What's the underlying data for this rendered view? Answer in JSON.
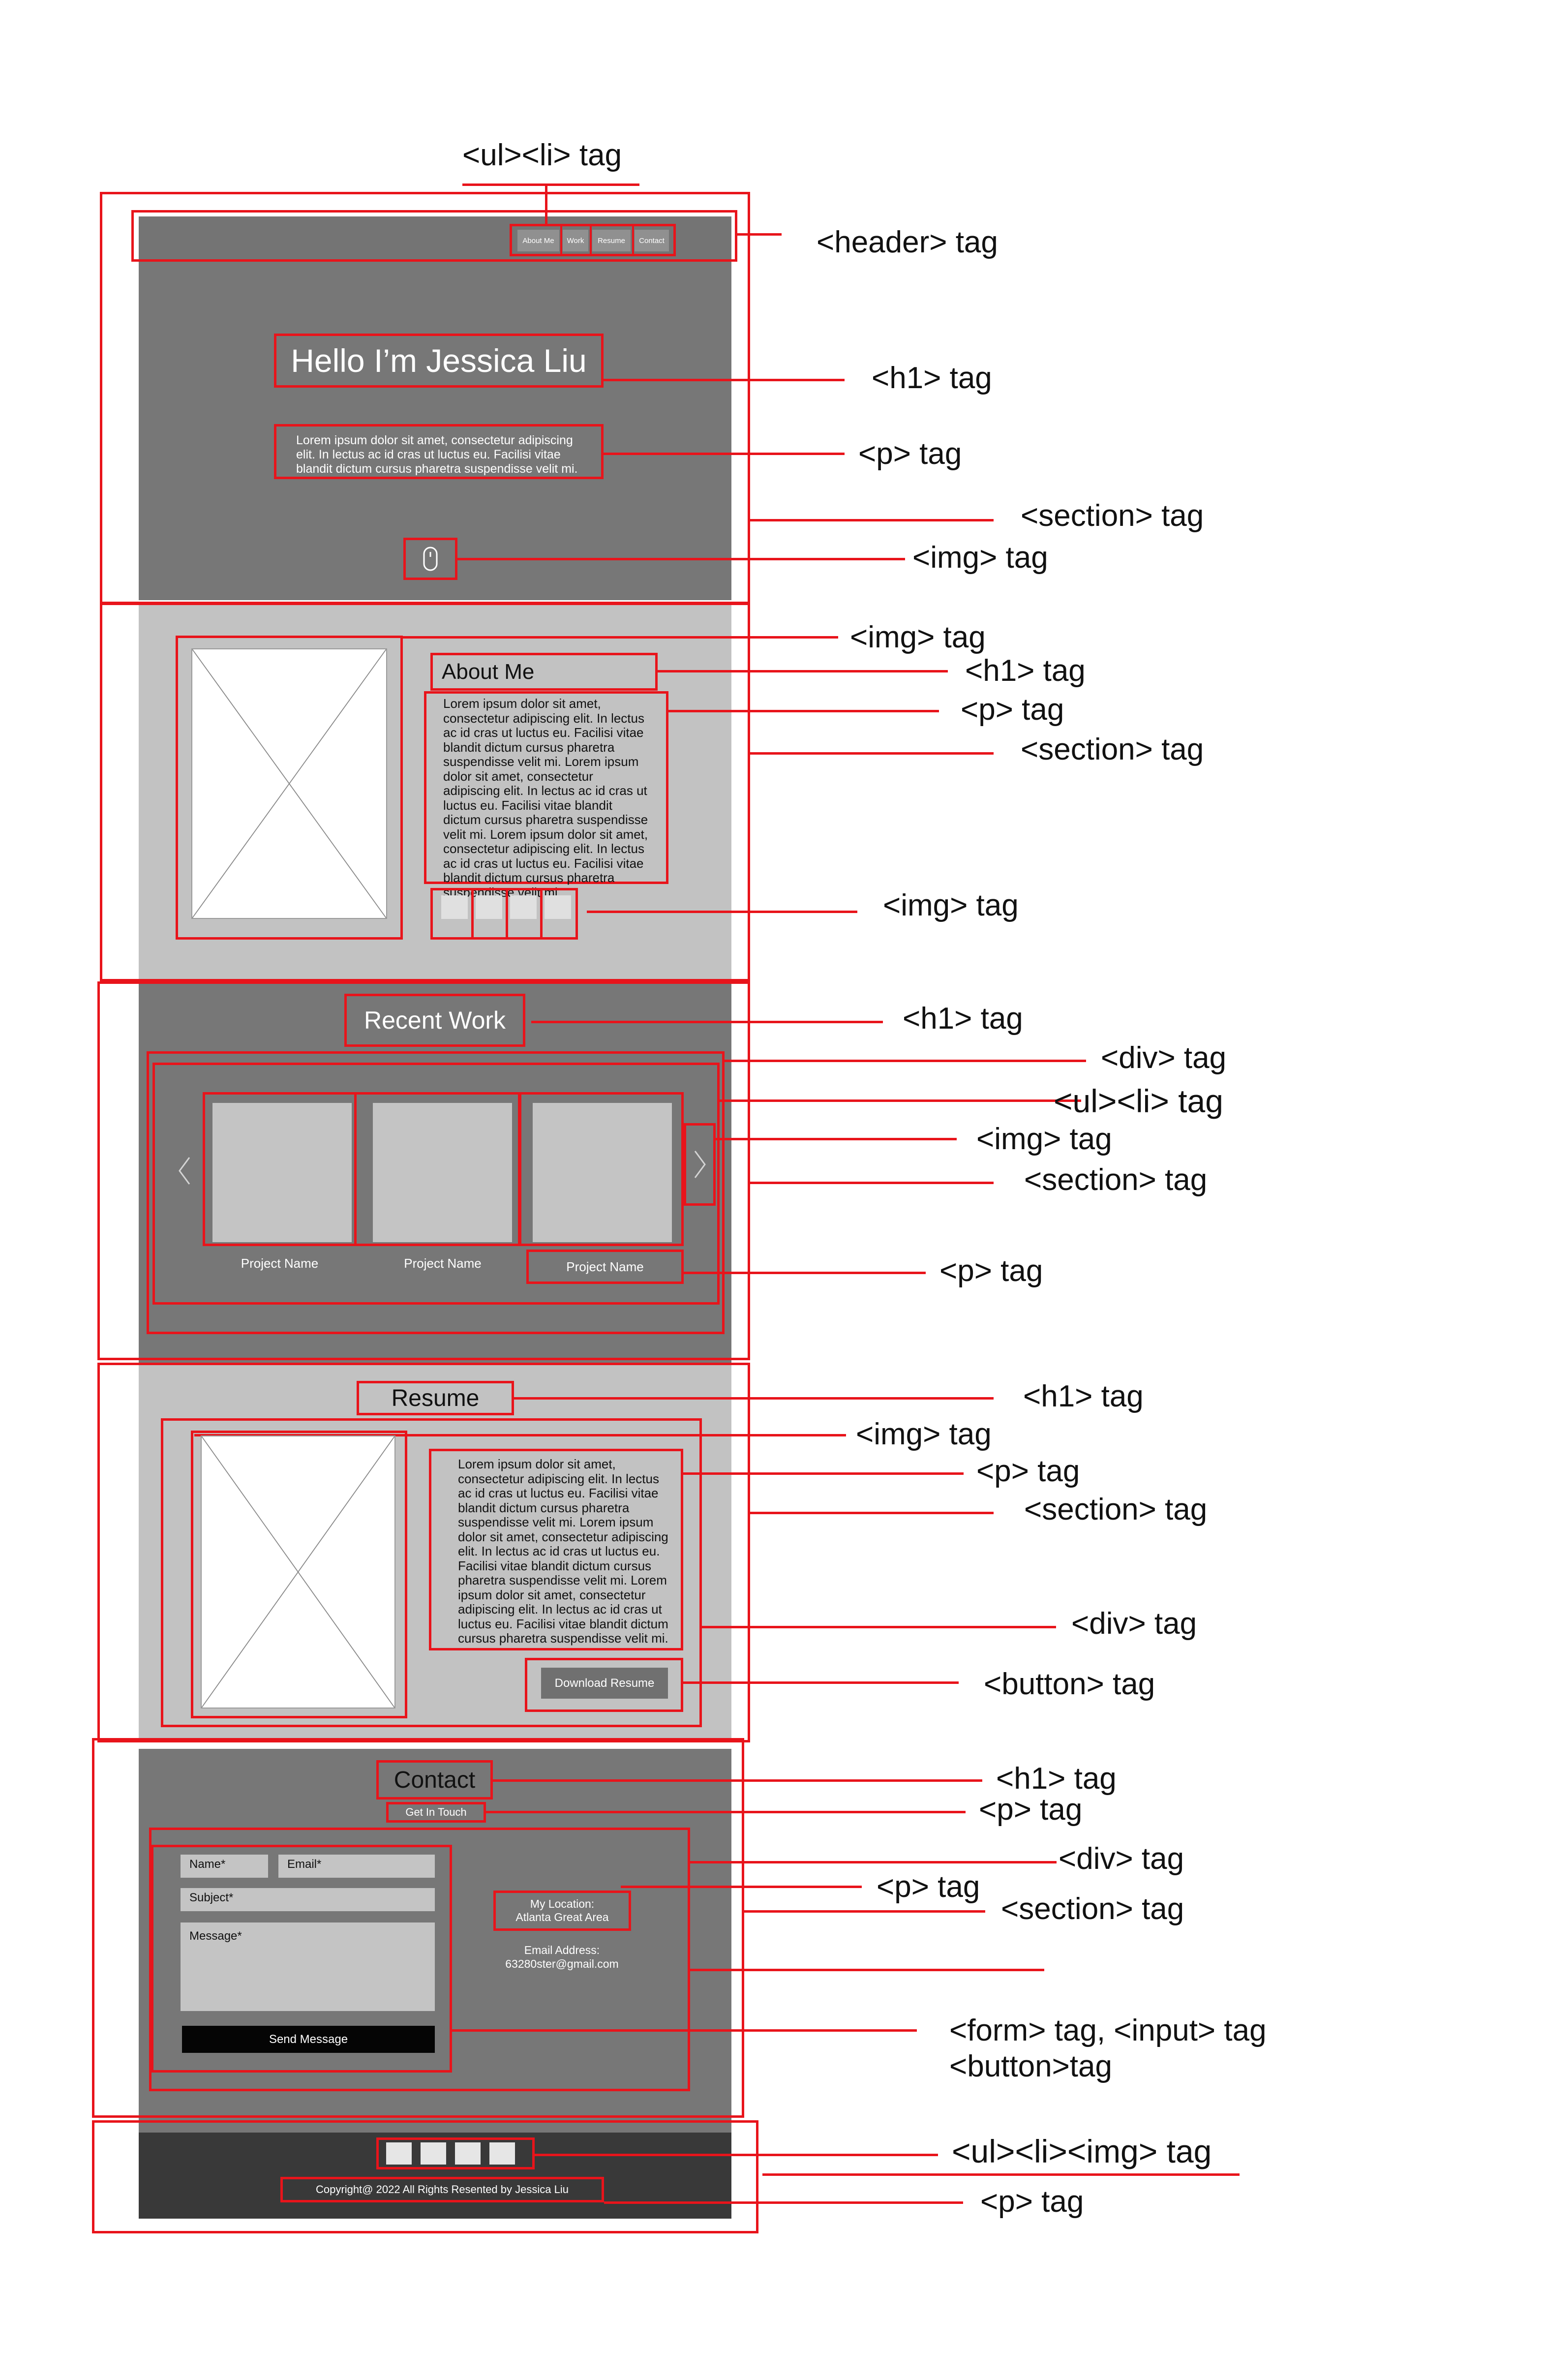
{
  "annotations": {
    "nav_list": "<ul><li> tag",
    "header": "<header> tag",
    "hero_h1": "<h1> tag",
    "hero_p": "<p> tag",
    "hero_section": "<section> tag",
    "hero_img": "<img> tag",
    "about_img": "<img> tag",
    "about_h1": "<h1> tag",
    "about_p": "<p> tag",
    "about_section": "<section> tag",
    "about_icons": "<img> tag",
    "work_h1": "<h1> tag",
    "work_div": "<div> tag",
    "work_list": "<ul><li> tag",
    "work_img": "<img> tag",
    "work_section": "<section> tag",
    "work_p": "<p> tag",
    "resume_h1": "<h1> tag",
    "resume_img": "<img> tag",
    "resume_p": "<p> tag",
    "resume_section": "<section> tag",
    "resume_div": "<div> tag",
    "resume_button": "<button> tag",
    "contact_h1": "<h1> tag",
    "contact_p": "<p> tag",
    "contact_div": "<div> tag",
    "contact_p2": "<p> tag",
    "contact_section": "<section> tag",
    "contact_form_1": "<form> tag, <input> tag",
    "contact_form_2": "<button>tag",
    "footer_list": "<ul><li><img> tag",
    "footer_p": "<p> tag"
  },
  "nav": {
    "items": [
      "About Me",
      "Work",
      "Resume",
      "Contact"
    ]
  },
  "hero": {
    "title": "Hello I’m Jessica Liu",
    "text": "Lorem ipsum dolor sit amet, consectetur adipiscing elit. In lectus ac id cras ut luctus eu. Facilisi vitae blandit dictum cursus pharetra suspendisse velit mi."
  },
  "about": {
    "title": "About Me",
    "text": "Lorem ipsum dolor sit amet, consectetur adipiscing elit. In lectus ac id cras ut luctus eu. Facilisi vitae blandit dictum cursus pharetra suspendisse velit mi. Lorem ipsum dolor sit amet, consectetur adipiscing elit. In lectus ac id cras ut luctus eu. Facilisi vitae blandit dictum cursus pharetra suspendisse velit mi. Lorem ipsum dolor sit amet, consectetur adipiscing elit. In lectus ac id cras ut luctus eu. Facilisi vitae blandit dictum cursus pharetra suspendisse velit mi."
  },
  "work": {
    "title": "Recent Work",
    "projects": [
      "Project Name",
      "Project Name",
      "Project Name"
    ]
  },
  "resume": {
    "title": "Resume",
    "text": "Lorem ipsum dolor sit amet, consectetur adipiscing elit. In lectus ac id cras ut luctus eu. Facilisi vitae blandit dictum cursus pharetra suspendisse velit mi. Lorem ipsum dolor sit amet, consectetur adipiscing elit. In lectus ac id cras ut luctus eu. Facilisi vitae blandit dictum cursus pharetra suspendisse velit mi. Lorem ipsum dolor sit amet, consectetur adipiscing elit. In lectus ac id cras ut luctus eu. Facilisi vitae blandit dictum cursus pharetra suspendisse velit mi.",
    "button": "Download Resume"
  },
  "contact": {
    "title": "Contact",
    "subtitle": "Get In Touch",
    "name_placeholder": "Name*",
    "email_placeholder": "Email*",
    "subject_placeholder": "Subject*",
    "message_placeholder": "Message*",
    "send_button": "Send Message",
    "location_label": "My Location:",
    "location_value": "Atlanta Great Area",
    "email_label": "Email Address:",
    "email_value": "63280ster@gmail.com"
  },
  "footer": {
    "copyright": "Copyright@ 2022 All Rights Resented by Jessica Liu"
  },
  "colors": {
    "annotation_red": "#e8141b",
    "dark_gray": "#777777",
    "light_gray": "#c2c2c2",
    "footer_dark": "#393939"
  }
}
